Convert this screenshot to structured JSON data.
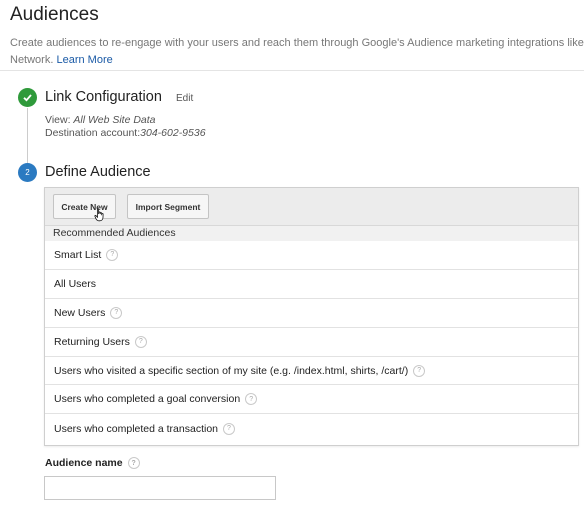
{
  "header": {
    "title": "Audiences",
    "intro_text": "Create audiences to re-engage with your users and reach them through Google's Audience marketing integrations like F",
    "intro_text_line2": "Network.",
    "learn_more": "Learn More"
  },
  "step1": {
    "title": "Link Configuration",
    "edit_label": "Edit",
    "view_label": "View:",
    "view_value": "All Web Site Data",
    "dest_label": "Destination account:",
    "dest_value": "304-602-9536"
  },
  "step2": {
    "number": "2",
    "title": "Define Audience"
  },
  "panel": {
    "create_new": "Create New",
    "import_segment": "Import Segment",
    "section_header": "Recommended Audiences",
    "rows": [
      {
        "label": "Smart List",
        "help": true
      },
      {
        "label": "All Users",
        "help": false
      },
      {
        "label": "New Users",
        "help": true
      },
      {
        "label": "Returning Users",
        "help": true
      },
      {
        "label": "Users who visited a specific section of my site (e.g. /index.html, shirts, /cart/)",
        "help": true
      },
      {
        "label": "Users who completed a goal conversion",
        "help": true
      },
      {
        "label": "Users who completed a transaction",
        "help": true
      }
    ]
  },
  "audience_name": {
    "label": "Audience name",
    "value": ""
  },
  "colors": {
    "check_green": "#2f9a3b",
    "step_blue": "#2b7ac1",
    "link_blue": "#1a5aa6"
  }
}
